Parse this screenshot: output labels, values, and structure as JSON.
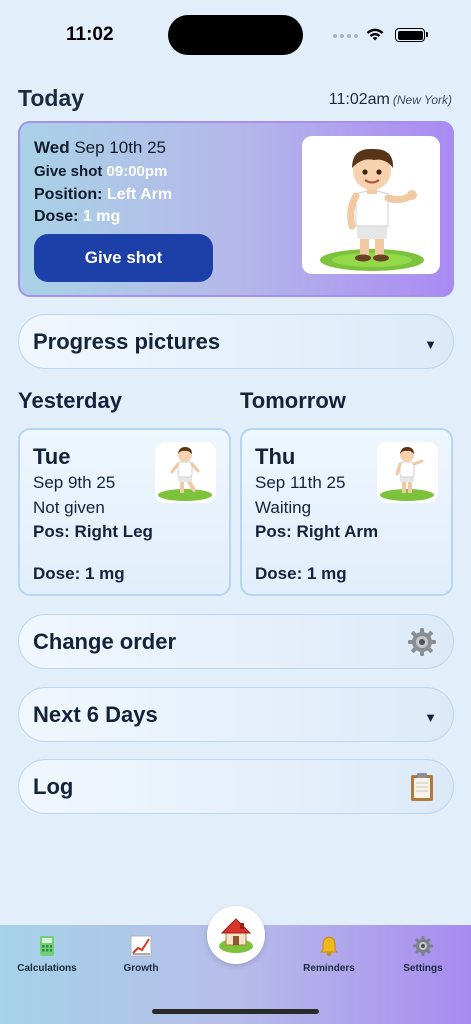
{
  "status_bar": {
    "time": "11:02"
  },
  "header": {
    "title": "Today",
    "current_time": "11:02am",
    "timezone": "(New York)"
  },
  "today_card": {
    "weekday": "Wed",
    "date": "Sep 10th 25",
    "shot_label": "Give shot",
    "shot_time": "09:00pm",
    "position_label": "Position:",
    "position_value": "Left Arm",
    "dose_label": "Dose:",
    "dose_value": "1 mg",
    "button_label": "Give shot",
    "image_icon": "boy-pointing-icon"
  },
  "progress_pictures": {
    "label": "Progress pictures",
    "caret": "▼"
  },
  "yesterday": {
    "heading": "Yesterday",
    "weekday": "Tue",
    "date": "Sep 9th 25",
    "status": "Not given",
    "position": "Pos: Right Leg",
    "dose": "Dose: 1 mg",
    "image_icon": "boy-leg-icon"
  },
  "tomorrow": {
    "heading": "Tomorrow",
    "weekday": "Thu",
    "date": "Sep 11th 25",
    "status": "Waiting",
    "position": "Pos: Right Arm",
    "dose": "Dose: 1 mg",
    "image_icon": "boy-arm-icon"
  },
  "change_order": {
    "label": "Change order",
    "icon": "gear-icon"
  },
  "next_days": {
    "label": "Next 6 Days",
    "caret": "▼"
  },
  "log": {
    "label": "Log",
    "icon": "clipboard-icon"
  },
  "tab_bar": {
    "calculations": "Calculations",
    "growth": "Growth",
    "home_icon": "house-icon",
    "reminders": "Reminders",
    "settings": "Settings"
  },
  "colors": {
    "accent": "#1c3fa8",
    "card_gradient_start": "#a9d2e6",
    "card_gradient_end": "#a98af2",
    "background": "#e3eefb"
  }
}
